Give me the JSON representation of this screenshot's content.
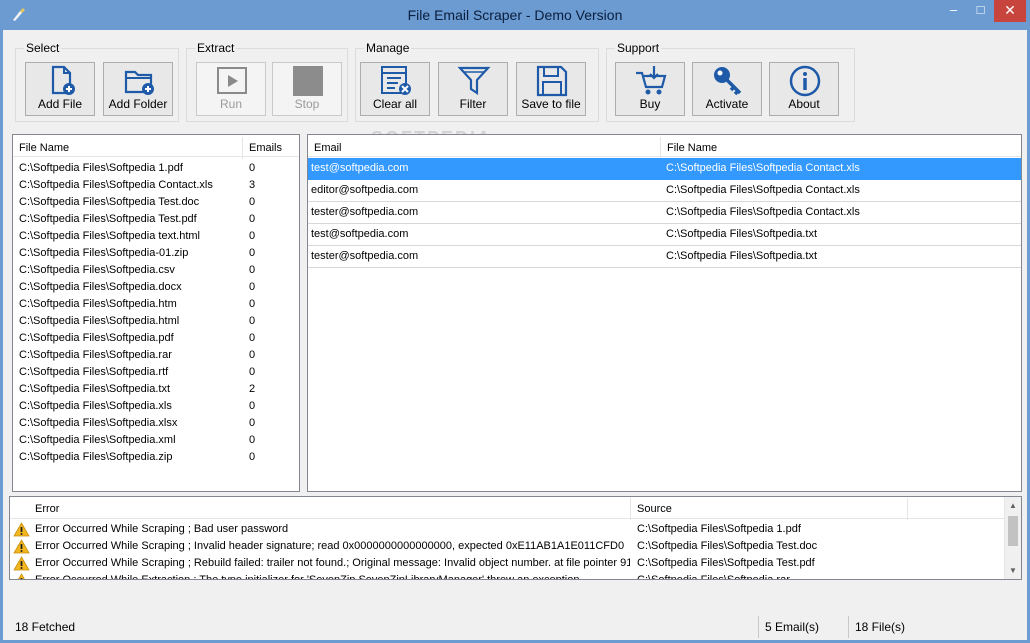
{
  "window": {
    "title": "File Email Scraper - Demo Version"
  },
  "toolbar": {
    "groups": [
      {
        "label": "Select",
        "buttons": [
          {
            "label": "Add File",
            "icon": "add-file-icon"
          },
          {
            "label": "Add Folder",
            "icon": "add-folder-icon"
          }
        ]
      },
      {
        "label": "Extract",
        "buttons": [
          {
            "label": "Run",
            "icon": "run-icon",
            "disabled": true
          },
          {
            "label": "Stop",
            "icon": "stop-icon",
            "disabled": true
          }
        ]
      },
      {
        "label": "Manage",
        "buttons": [
          {
            "label": "Clear all",
            "icon": "clear-all-icon"
          },
          {
            "label": "Filter",
            "icon": "filter-icon"
          },
          {
            "label": "Save to file",
            "icon": "save-icon"
          }
        ]
      },
      {
        "label": "Support",
        "buttons": [
          {
            "label": "Buy",
            "icon": "cart-icon"
          },
          {
            "label": "Activate",
            "icon": "key-icon"
          },
          {
            "label": "About",
            "icon": "info-icon"
          }
        ]
      }
    ]
  },
  "watermark": "SOFTPEDIA",
  "files": {
    "headers": {
      "name": "File Name",
      "emails": "Emails"
    },
    "rows": [
      {
        "name": "C:\\Softpedia Files\\Softpedia 1.pdf",
        "emails": "0"
      },
      {
        "name": "C:\\Softpedia Files\\Softpedia Contact.xls",
        "emails": "3"
      },
      {
        "name": "C:\\Softpedia Files\\Softpedia Test.doc",
        "emails": "0"
      },
      {
        "name": "C:\\Softpedia Files\\Softpedia Test.pdf",
        "emails": "0"
      },
      {
        "name": "C:\\Softpedia Files\\Softpedia text.html",
        "emails": "0"
      },
      {
        "name": "C:\\Softpedia Files\\Softpedia-01.zip",
        "emails": "0"
      },
      {
        "name": "C:\\Softpedia Files\\Softpedia.csv",
        "emails": "0"
      },
      {
        "name": "C:\\Softpedia Files\\Softpedia.docx",
        "emails": "0"
      },
      {
        "name": "C:\\Softpedia Files\\Softpedia.htm",
        "emails": "0"
      },
      {
        "name": "C:\\Softpedia Files\\Softpedia.html",
        "emails": "0"
      },
      {
        "name": "C:\\Softpedia Files\\Softpedia.pdf",
        "emails": "0"
      },
      {
        "name": "C:\\Softpedia Files\\Softpedia.rar",
        "emails": "0"
      },
      {
        "name": "C:\\Softpedia Files\\Softpedia.rtf",
        "emails": "0"
      },
      {
        "name": "C:\\Softpedia Files\\Softpedia.txt",
        "emails": "2"
      },
      {
        "name": "C:\\Softpedia Files\\Softpedia.xls",
        "emails": "0"
      },
      {
        "name": "C:\\Softpedia Files\\Softpedia.xlsx",
        "emails": "0"
      },
      {
        "name": "C:\\Softpedia Files\\Softpedia.xml",
        "emails": "0"
      },
      {
        "name": "C:\\Softpedia Files\\Softpedia.zip",
        "emails": "0"
      }
    ]
  },
  "emails": {
    "headers": {
      "email": "Email",
      "file": "File Name"
    },
    "selected_index": 0,
    "rows": [
      {
        "email": "test@softpedia.com",
        "file": "C:\\Softpedia Files\\Softpedia Contact.xls"
      },
      {
        "email": "editor@softpedia.com",
        "file": "C:\\Softpedia Files\\Softpedia Contact.xls"
      },
      {
        "email": "tester@softpedia.com",
        "file": "C:\\Softpedia Files\\Softpedia Contact.xls"
      },
      {
        "email": "test@softpedia.com",
        "file": "C:\\Softpedia Files\\Softpedia.txt"
      },
      {
        "email": "tester@softpedia.com",
        "file": "C:\\Softpedia Files\\Softpedia.txt"
      }
    ]
  },
  "errors": {
    "headers": {
      "error": "Error",
      "source": "Source"
    },
    "rows": [
      {
        "error": "Error Occurred While Scraping ; Bad user password",
        "source": "C:\\Softpedia Files\\Softpedia 1.pdf"
      },
      {
        "error": "Error Occurred While Scraping ; Invalid header signature; read 0x0000000000000000, expected 0xE11AB1A1E011CFD0",
        "source": "C:\\Softpedia Files\\Softpedia Test.doc"
      },
      {
        "error": "Error Occurred While Scraping ; Rebuild failed: trailer not found.; Original message: Invalid object number. at file pointer 91",
        "source": "C:\\Softpedia Files\\Softpedia Test.pdf"
      },
      {
        "error": "Error Occurred While Extraction ; The type initializer for 'SevenZip.SevenZipLibraryManager' threw an exception.",
        "source": "C:\\Softpedia Files\\Softpedia.rar"
      }
    ]
  },
  "status": {
    "fetched": "18 Fetched File(s)",
    "emails": "5 Email(s)",
    "files": "18 File(s)"
  },
  "colors": {
    "selection": "#3399ff",
    "titlebar": "#6b9bd1",
    "close": "#c7453c",
    "icon_blue": "#1e5aa8"
  }
}
